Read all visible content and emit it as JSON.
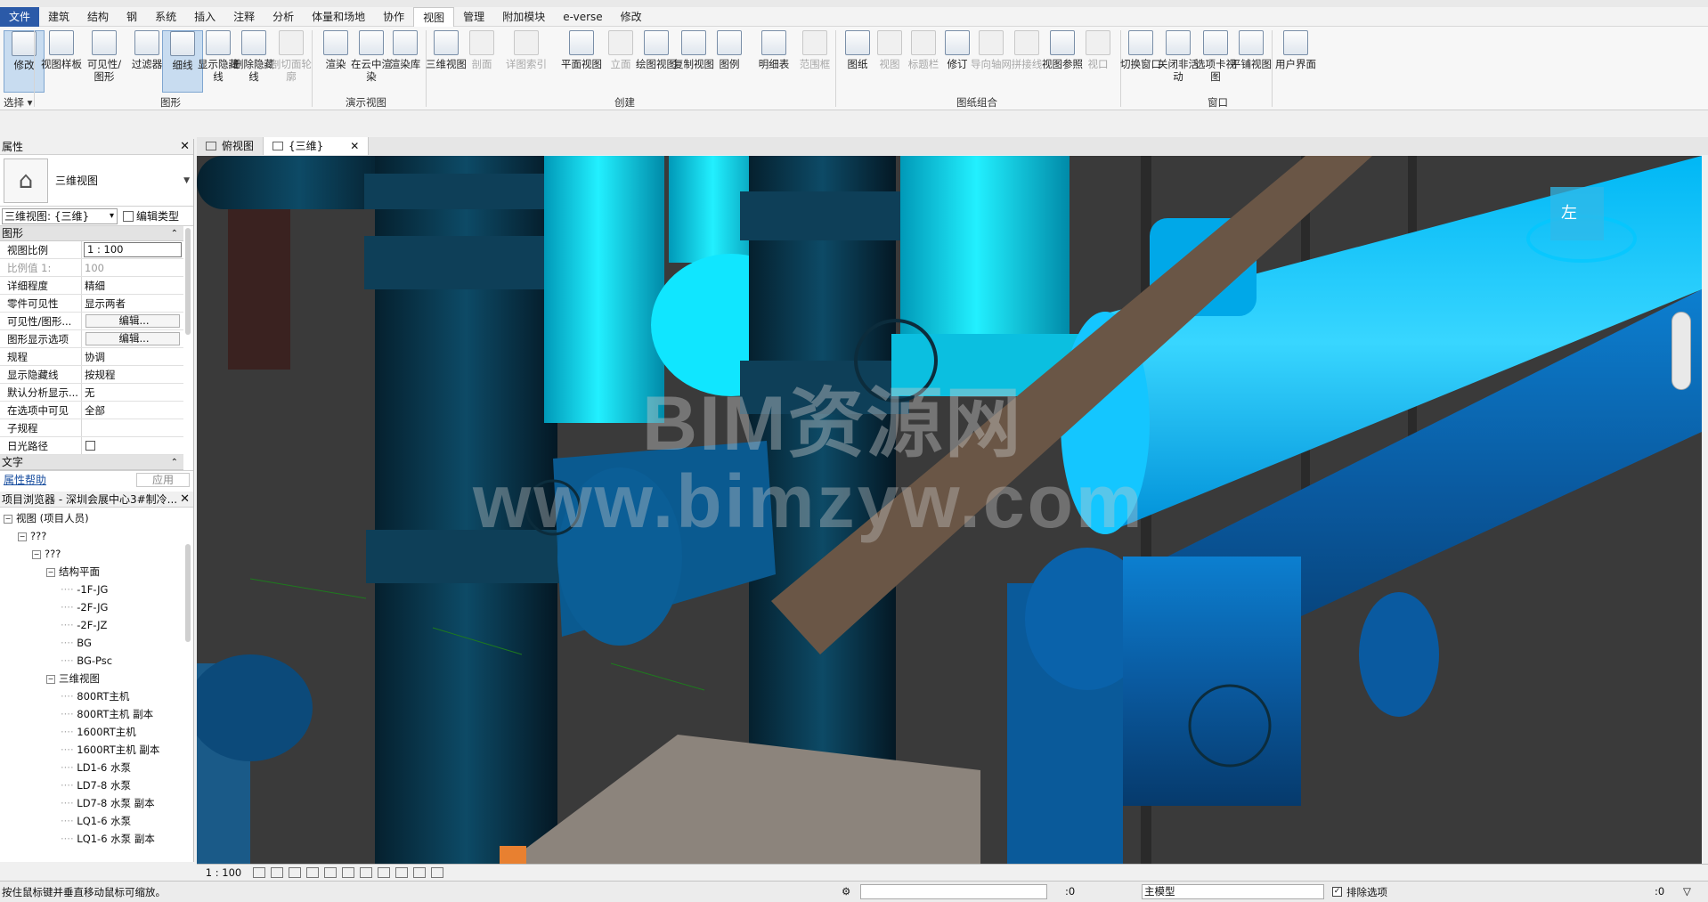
{
  "menu": {
    "tabs": [
      "文件",
      "建筑",
      "结构",
      "钢",
      "系统",
      "插入",
      "注释",
      "分析",
      "体量和场地",
      "协作",
      "视图",
      "管理",
      "附加模块",
      "e-verse",
      "修改"
    ],
    "active_tab": "视图"
  },
  "ribbon": {
    "modify": "修改",
    "select": "选择",
    "graphics": {
      "label": "图形",
      "buttons": [
        "视图样板",
        "可见性/图形",
        "过滤器",
        "细线",
        "显示隐藏线",
        "删除隐藏线",
        "剖切面轮廓"
      ]
    },
    "presentation": {
      "label": "演示视图",
      "buttons": [
        "渲染",
        "在云中渲染",
        "渲染库"
      ]
    },
    "create": {
      "label": "创建",
      "buttons": [
        "三维视图",
        "剖面",
        "详图索引",
        "平面视图",
        "立面",
        "绘图视图",
        "复制视图",
        "图例",
        "明细表",
        "范围框"
      ]
    },
    "sheet": {
      "label": "图纸组合",
      "buttons": [
        "图纸",
        "视图",
        "标题栏",
        "修订",
        "导向轴网",
        "拼接线",
        "视图参照",
        "视口"
      ]
    },
    "windows": {
      "label": "窗口",
      "buttons": [
        "切换窗口",
        "关闭非活动",
        "选项卡视图",
        "平铺视图"
      ]
    },
    "ui": {
      "buttons": [
        "用户界面"
      ]
    }
  },
  "properties": {
    "title": "属性",
    "type_name": "三维视图",
    "view_selector": "三维视图: {三维}",
    "edit_type": "编辑类型",
    "group_graphics": "图形",
    "rows": [
      {
        "k": "视图比例",
        "v": "1 : 100"
      },
      {
        "k": "比例值 1:",
        "v": "100"
      },
      {
        "k": "详细程度",
        "v": "精细"
      },
      {
        "k": "零件可见性",
        "v": "显示两者"
      },
      {
        "k": "可见性/图形...",
        "v": "编辑..."
      },
      {
        "k": "图形显示选项",
        "v": "编辑..."
      },
      {
        "k": "规程",
        "v": "协调"
      },
      {
        "k": "显示隐藏线",
        "v": "按规程"
      },
      {
        "k": "默认分析显示...",
        "v": "无"
      },
      {
        "k": "在选项中可见",
        "v": "全部"
      },
      {
        "k": "子规程",
        "v": ""
      },
      {
        "k": "日光路径",
        "v": ""
      }
    ],
    "group_text": "文字",
    "help": "属性帮助",
    "apply": "应用"
  },
  "browser": {
    "title": "项目浏览器 - 深圳会展中心3#制冷...",
    "items": [
      {
        "label": "视图 (项目人员)",
        "level": 0,
        "tog": "⊟"
      },
      {
        "label": "???",
        "level": 1,
        "tog": "⊟"
      },
      {
        "label": "???",
        "level": 2,
        "tog": "⊟"
      },
      {
        "label": "结构平面",
        "level": 3,
        "tog": "⊟"
      },
      {
        "label": "-1F-JG",
        "level": 4,
        "tog": ""
      },
      {
        "label": "-2F-JG",
        "level": 4,
        "tog": ""
      },
      {
        "label": "-2F-JZ",
        "level": 4,
        "tog": ""
      },
      {
        "label": "BG",
        "level": 4,
        "tog": ""
      },
      {
        "label": "BG-Psc",
        "level": 4,
        "tog": ""
      },
      {
        "label": "三维视图",
        "level": 3,
        "tog": "⊟"
      },
      {
        "label": "800RT主机",
        "level": 4,
        "tog": ""
      },
      {
        "label": "800RT主机 副本",
        "level": 4,
        "tog": ""
      },
      {
        "label": "1600RT主机",
        "level": 4,
        "tog": ""
      },
      {
        "label": "1600RT主机 副本",
        "level": 4,
        "tog": ""
      },
      {
        "label": "LD1-6 水泵",
        "level": 4,
        "tog": ""
      },
      {
        "label": "LD7-8 水泵",
        "level": 4,
        "tog": ""
      },
      {
        "label": "LD7-8 水泵 副本",
        "level": 4,
        "tog": ""
      },
      {
        "label": "LQ1-6 水泵",
        "level": 4,
        "tog": ""
      },
      {
        "label": "LQ1-6 水泵 副本",
        "level": 4,
        "tog": ""
      }
    ]
  },
  "view_tabs": [
    {
      "label": "俯视图",
      "active": false
    },
    {
      "label": "{三维}",
      "active": true
    }
  ],
  "viewport": {
    "watermark_line1": "BIM资源网",
    "watermark_line2": "www.bimzyw.com",
    "viewcube_face": "左",
    "pipe_colors": {
      "cyan": "#00d8f0",
      "blue": "#0a6ec0",
      "dark": "#0a3550",
      "beam": "#6a5646",
      "concrete": "#8c847c",
      "bg": "#3a3a3a"
    }
  },
  "view_control": {
    "scale": "1 : 100"
  },
  "status": {
    "message": "按住鼠标键并垂直移动鼠标可缩放。",
    "zero1": ":0",
    "model": "主模型",
    "exclude": "排除选项",
    "zero2": ":0"
  }
}
